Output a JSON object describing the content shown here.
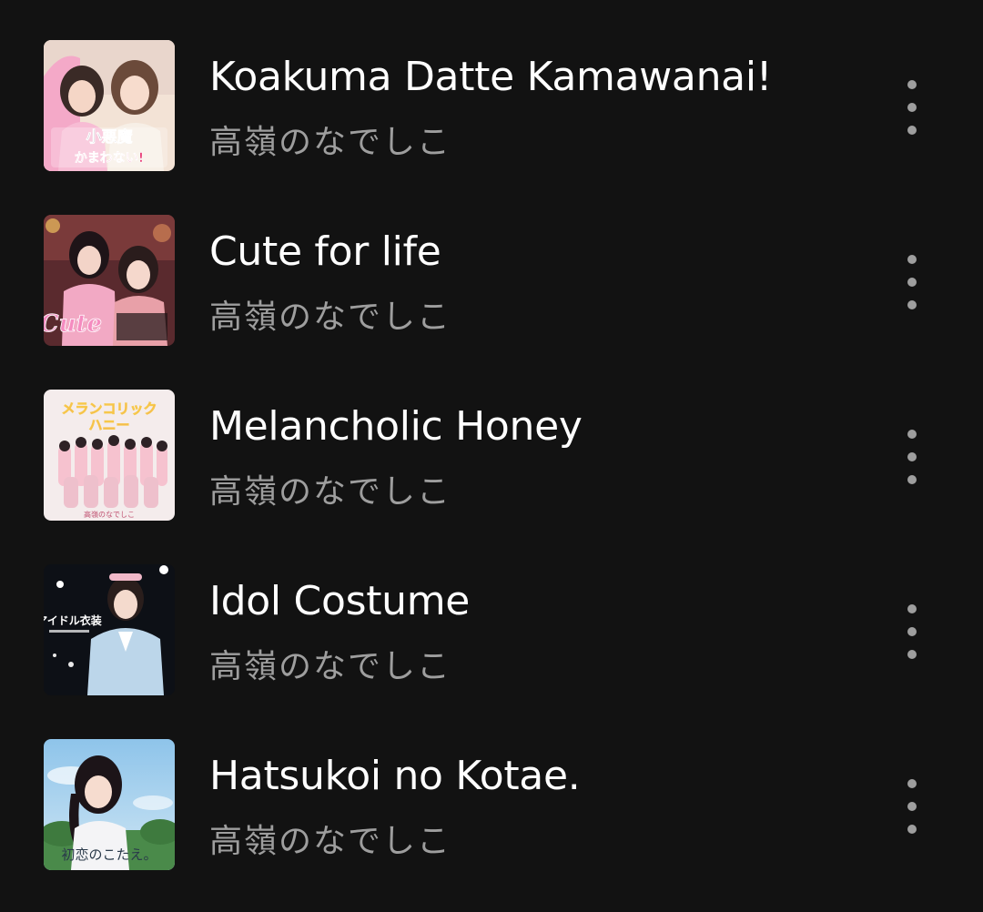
{
  "tracks": [
    {
      "title": "Koakuma Datte Kamawanai!",
      "artist": "高嶺のなでしこ",
      "art_label": "小悪魔だってかまわない!"
    },
    {
      "title": "Cute for life",
      "artist": "高嶺のなでしこ",
      "art_label": "Cute"
    },
    {
      "title": "Melancholic Honey",
      "artist": "高嶺のなでしこ",
      "art_label": "メランコリックハニー",
      "art_sublabel": "高嶺のなでしこ"
    },
    {
      "title": "Idol Costume",
      "artist": "高嶺のなでしこ",
      "art_label": "アイドル衣装"
    },
    {
      "title": "Hatsukoi no Kotae.",
      "artist": "高嶺のなでしこ",
      "art_label": "初恋のこたえ。"
    }
  ],
  "icons": {
    "more": "more-vert-icon"
  },
  "colors": {
    "background": "#121212",
    "title": "#ffffff",
    "subtitle": "#9e9e9e",
    "more_icon": "#9e9e9e"
  }
}
